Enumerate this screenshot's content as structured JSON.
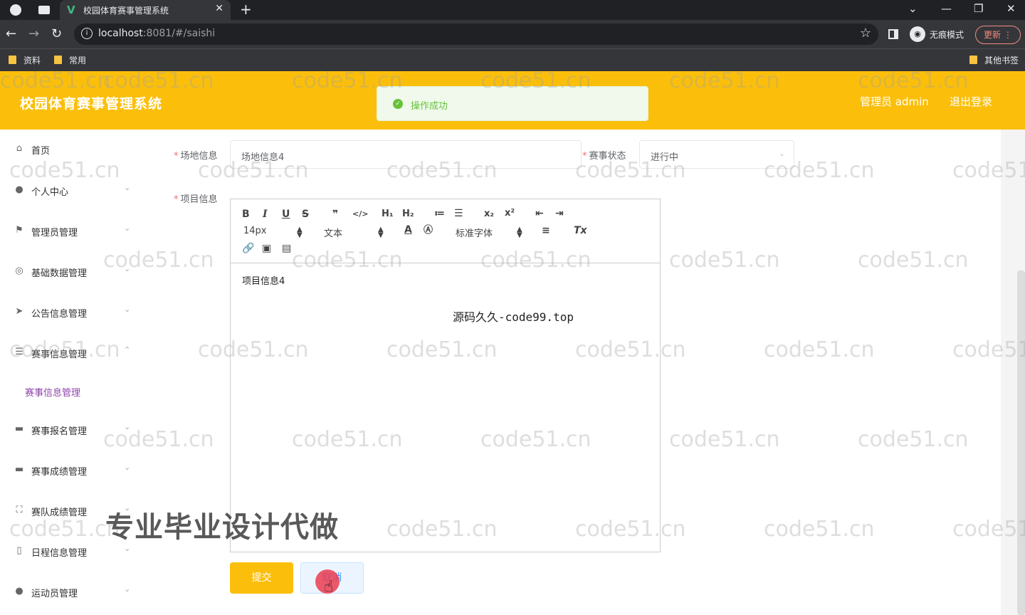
{
  "browser": {
    "tab_title": "校园体育赛事管理系统",
    "url_host": "localhost",
    "url_rest": ":8081/#/saishi",
    "incognito_label": "无痕模式",
    "update_label": "更新",
    "bookmarks": [
      "资料",
      "常用"
    ],
    "other_bookmarks": "其他书签"
  },
  "header": {
    "title": "校园体育赛事管理系统",
    "user_label": "管理员 admin",
    "logout_label": "退出登录"
  },
  "toast": {
    "message": "操作成功",
    "icon": "success-check-icon"
  },
  "sidebar": {
    "items": [
      {
        "label": "首页",
        "icon": "home-icon"
      },
      {
        "label": "个人中心",
        "icon": "user-icon"
      },
      {
        "label": "管理员管理",
        "icon": "flag-icon"
      },
      {
        "label": "基础数据管理",
        "icon": "circle-icon"
      },
      {
        "label": "公告信息管理",
        "icon": "send-icon"
      },
      {
        "label": "赛事信息管理",
        "icon": "list-icon"
      },
      {
        "label": "赛事报名管理",
        "icon": "monitor-icon"
      },
      {
        "label": "赛事成绩管理",
        "icon": "monitor-icon"
      },
      {
        "label": "赛队成绩管理",
        "icon": "fullscreen-icon"
      },
      {
        "label": "日程信息管理",
        "icon": "phone-icon"
      },
      {
        "label": "运动员管理",
        "icon": "location-icon"
      }
    ],
    "active_submenu": "赛事信息管理"
  },
  "form": {
    "venue_label": "场地信息",
    "venue_value": "场地信息4",
    "status_label": "赛事状态",
    "status_value": "进行中",
    "project_label": "项目信息",
    "editor_content": "项目信息4",
    "submit_label": "提交",
    "cancel_label": "取消"
  },
  "editor_toolbar": {
    "font_size": "14px",
    "header_select": "文本",
    "font_family": "标准字体"
  },
  "overlays": {
    "watermark": "code51.cn",
    "banner": "专业毕业设计代做",
    "site_mark": "源码久久-code99.top"
  }
}
